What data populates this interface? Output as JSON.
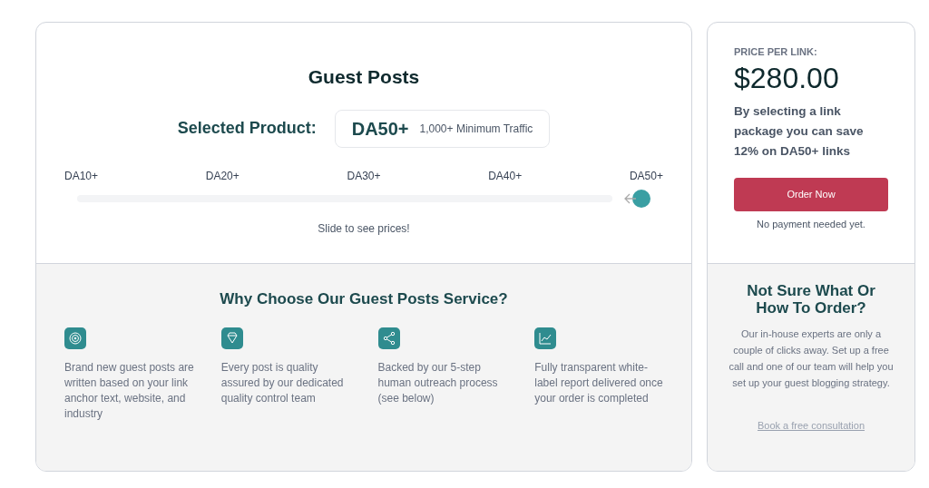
{
  "product": {
    "title": "Guest Posts",
    "selected_label": "Selected Product:",
    "selected_name": "DA50+",
    "selected_note": "1,000+ Minimum Traffic"
  },
  "slider": {
    "stops": [
      "DA10+",
      "DA20+",
      "DA30+",
      "DA40+",
      "DA50+"
    ],
    "level": 1,
    "hint": "Slide to see prices!"
  },
  "why": {
    "title": "Why Choose Our Guest Posts Service?",
    "features": [
      {
        "kind": "target",
        "text": "Brand new guest posts are written based on your link anchor text, website, and industry"
      },
      {
        "kind": "diamond",
        "text": "Every post is quality assured by our dedicated quality control team"
      },
      {
        "kind": "share",
        "text": "Backed by our 5-step human outreach process (see below)"
      },
      {
        "kind": "chart",
        "text": "Fully transparent white-label report delivered once your order is completed"
      }
    ]
  },
  "price": {
    "label": "PRICE PER LINK:",
    "amount": "$280.00",
    "savings": "By selecting a link package you can save 12% on DA50+ links",
    "button": "Order Now",
    "note": "No payment needed yet."
  },
  "help": {
    "title": "Not Sure What Or How To Order?",
    "text": "Our in-house experts are only a couple of clicks away. Set up a free call and one of our team will help you set up your guest blogging strategy.",
    "link": "Book a free consultation"
  }
}
